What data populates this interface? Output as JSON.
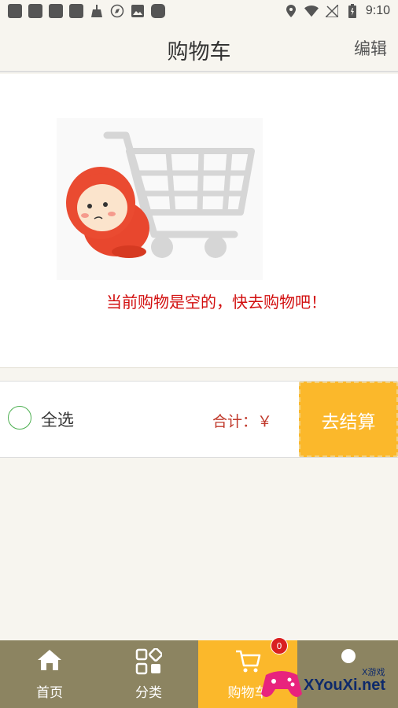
{
  "status_bar": {
    "time": "9:10"
  },
  "header": {
    "title": "购物车",
    "edit": "编辑"
  },
  "empty_state": {
    "message": "当前购物是空的，快去购物吧！"
  },
  "checkout": {
    "select_all": "全选",
    "total": "合计：￥",
    "pay_button": "去结算"
  },
  "tabs": [
    {
      "label": "首页",
      "icon": "home-icon"
    },
    {
      "label": "分类",
      "icon": "category-icon"
    },
    {
      "label": "购物车",
      "icon": "cart-icon",
      "badge": "0",
      "active": true
    },
    {
      "label": "",
      "icon": "user-icon"
    }
  ],
  "watermark": {
    "brand": "XYouXi.net",
    "tag": "X游戏"
  },
  "colors": {
    "accent": "#fbb82b",
    "tabbar": "#8c8461",
    "price": "#c0392b",
    "empty_text": "#d20f0f"
  }
}
